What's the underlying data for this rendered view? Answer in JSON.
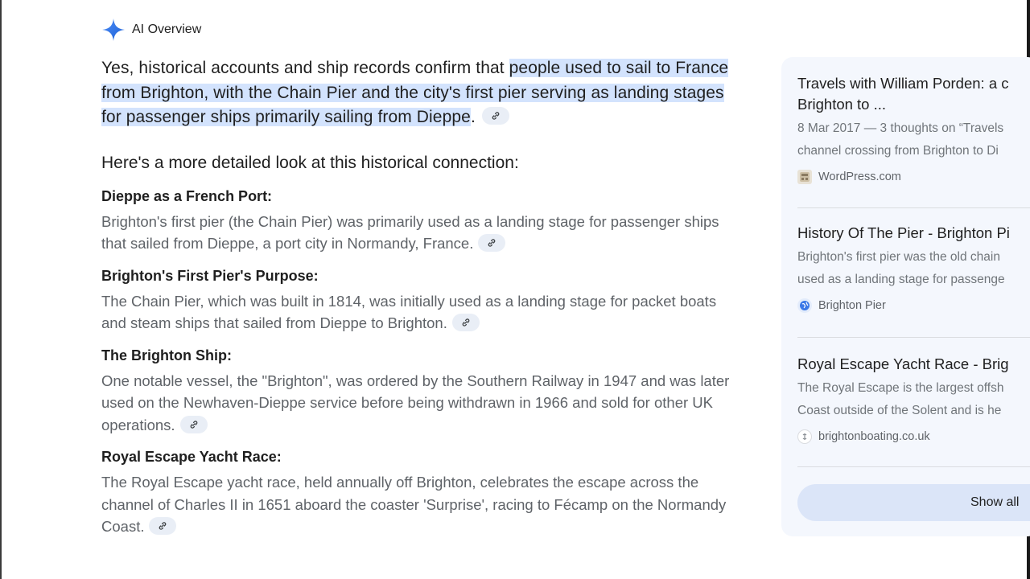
{
  "header": {
    "title": "AI Overview",
    "icon": "sparkle-icon"
  },
  "answer": {
    "lead_plain": "Yes, historical accounts and ship records confirm that ",
    "lead_highlight": "people used to sail to France from Brighton, with the Chain Pier and the city's first pier serving as landing stages for passenger ships primarily sailing from Dieppe",
    "lead_end": ".",
    "intro": "Here's a more detailed look at this historical connection:",
    "sections": [
      {
        "heading": "Dieppe as a French Port:",
        "body": "Brighton's first pier (the Chain Pier) was primarily used as a landing stage for passenger ships that sailed from Dieppe, a port city in Normandy, France."
      },
      {
        "heading": "Brighton's First Pier's Purpose:",
        "body": "The Chain Pier, which was built in 1814, was initially used as a landing stage for packet boats and steam ships that sailed from Dieppe to Brighton."
      },
      {
        "heading": "The Brighton Ship:",
        "body": "One notable vessel, the \"Brighton\", was ordered by the Southern Railway in 1947 and was later used on the Newhaven-Dieppe service before being withdrawn in 1966 and sold for other UK operations."
      },
      {
        "heading": "Royal Escape Yacht Race:",
        "body": "The Royal Escape yacht race, held annually off Brighton, celebrates the escape across the channel of Charles II in 1651 aboard the coaster 'Surprise', racing to Fécamp on the Normandy Coast."
      }
    ]
  },
  "sources": [
    {
      "title_line1": "Travels with William Porden: a c",
      "title_line2": "Brighton to ...",
      "desc_line1": "8 Mar 2017 — 3 thoughts on “Travels",
      "desc_line2": "channel crossing from Brighton to Di",
      "site": "WordPress.com"
    },
    {
      "title_line1": "History Of The Pier - Brighton Pi",
      "desc_line1": "Brighton's first pier was the old chain",
      "desc_line2": "used as a landing stage for passenge",
      "site": "Brighton Pier"
    },
    {
      "title_line1": "Royal Escape Yacht Race - Brig",
      "desc_line1": "The Royal Escape is the largest offsh",
      "desc_line2": "Coast outside of the Solent and is he",
      "site": "brightonboating.co.uk"
    }
  ],
  "show_all_label": "Show all",
  "colors": {
    "highlight": "#d3e3fd",
    "panel": "#f4f7fd",
    "chip": "#e9eef6",
    "sparkle": "#4285f4"
  }
}
